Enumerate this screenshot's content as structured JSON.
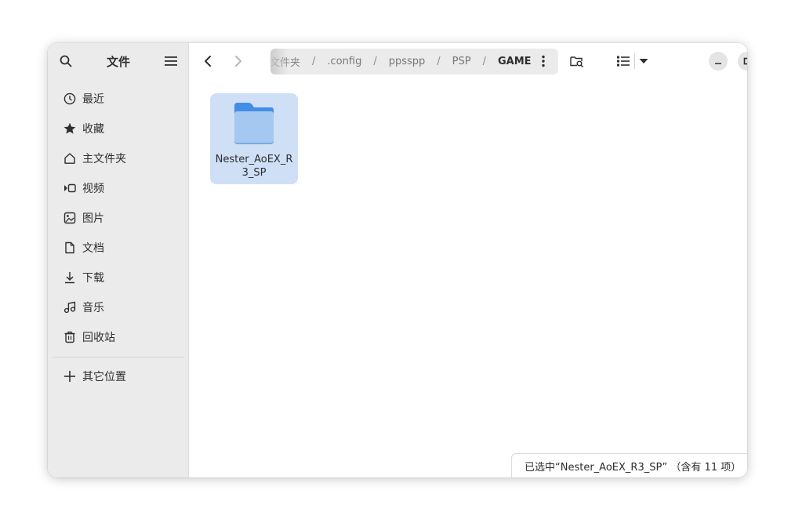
{
  "sidebar": {
    "title": "文件",
    "search_icon": "search-icon",
    "menu_icon": "hamburger-menu-icon",
    "items": [
      {
        "label": "最近",
        "icon": "clock-icon"
      },
      {
        "label": "收藏",
        "icon": "star-icon"
      },
      {
        "label": "主文件夹",
        "icon": "home-icon"
      },
      {
        "label": "视频",
        "icon": "video-icon"
      },
      {
        "label": "图片",
        "icon": "image-icon"
      },
      {
        "label": "文档",
        "icon": "document-icon"
      },
      {
        "label": "下载",
        "icon": "download-icon"
      },
      {
        "label": "音乐",
        "icon": "music-icon"
      },
      {
        "label": "回收站",
        "icon": "trash-icon"
      }
    ],
    "other_locations": {
      "label": "其它位置",
      "icon": "plus-icon"
    }
  },
  "header": {
    "back_icon": "chevron-left-icon",
    "forward_icon": "chevron-right-icon",
    "path": {
      "crumbs": [
        "文件夹",
        ".config",
        "ppsspp",
        "PSP"
      ],
      "separator": "/",
      "current": "GAME",
      "more_icon": "vertical-dots-icon"
    },
    "search_folder_icon": "folder-search-icon",
    "view_list_icon": "list-view-icon",
    "view_options_icon": "dropdown-arrow-icon",
    "window_controls": {
      "minimize_icon": "minimize-icon",
      "maximize_icon": "maximize-icon",
      "close_icon": "close-icon"
    }
  },
  "content": {
    "items": [
      {
        "name": "Nester_AoEX_R3_SP",
        "type": "folder",
        "selected": true
      }
    ]
  },
  "status_bar": {
    "text": "已选中“Nester_AoEX_R3_SP” （含有 11 项）"
  },
  "colors": {
    "accent": "#3584e4",
    "selection": "#cfdff6",
    "folder_body": "#a4c8f0",
    "folder_tab": "#438de6",
    "sidebar_bg": "#ebebeb"
  }
}
